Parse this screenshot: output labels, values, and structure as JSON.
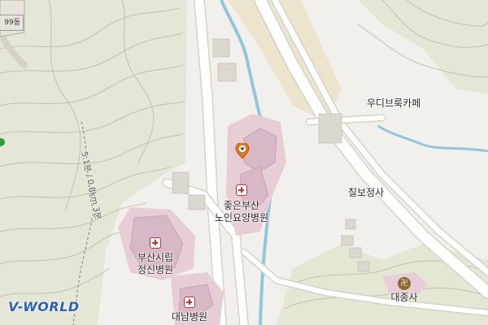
{
  "map": {
    "provider_logo": "V-WORLD",
    "marker_icon": "map-pin-icon",
    "corner_label": "99동",
    "pois": [
      {
        "id": "cafe",
        "name": "우디브룩카페",
        "icon": null
      },
      {
        "id": "temple1",
        "name": "칠보정사",
        "icon": null
      },
      {
        "id": "hospital1",
        "name": "좋은부산\n노인요양병원",
        "icon": "hospital-icon"
      },
      {
        "id": "hospital2",
        "name": "부산시립\n정신병원",
        "icon": "hospital-icon"
      },
      {
        "id": "hospital3",
        "name": "대남병원",
        "icon": "hospital-icon"
      },
      {
        "id": "temple2",
        "name": "대종사",
        "icon": "temple-icon",
        "icon_glyph": "卍"
      }
    ],
    "trail_label": "5.1분 / 0.8km 3분",
    "colors": {
      "background": "#f2f0ec",
      "forest": "#e4e6d6",
      "contour": "#b9b9a8",
      "road": "#ffffff",
      "road_casing": "#d6d2c8",
      "water": "#8fc8d8",
      "hospital_area": "#e6cdd6",
      "building": "#d8b8c6",
      "beige_area": "#ece4cc",
      "hospital_icon": "#d12f2f",
      "logo": "#2b62b8"
    }
  }
}
